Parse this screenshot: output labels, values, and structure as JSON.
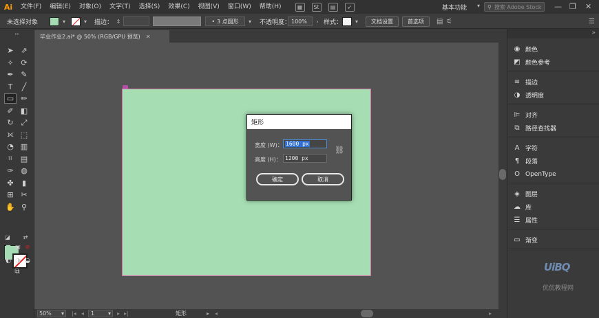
{
  "app": {
    "logo": "Ai"
  },
  "menu": [
    "文件(F)",
    "编辑(E)",
    "对象(O)",
    "文字(T)",
    "选择(S)",
    "效果(C)",
    "视图(V)",
    "窗口(W)",
    "帮助(H)"
  ],
  "menu_icons": [
    "br-icon",
    "stock-icon",
    "arrange-documents-icon",
    "gpu-performance-icon"
  ],
  "menu_icon_glyphs": [
    "▦",
    "St",
    "▤",
    "➶"
  ],
  "workspace": {
    "label": "基本功能"
  },
  "search": {
    "placeholder": "搜索 Adobe Stock"
  },
  "window_controls": [
    "—",
    "❐",
    "✕"
  ],
  "control_bar": {
    "selection": "未选择对象",
    "fill_color": "#a6dcb3",
    "stroke_label": "描边：",
    "brush": "3 点圆形",
    "opacity_label": "不透明度：",
    "opacity_value": "100%",
    "style_label": "样式：",
    "doc_setup": "文档设置",
    "preferences": "首选项"
  },
  "document_tab": {
    "title": "毕业作业2.ai* @ 50% (RGB/GPU 预览)",
    "close": "✕"
  },
  "tools": [
    "selection-tool",
    "direct-selection-tool",
    "magic-wand-tool",
    "lasso-tool",
    "pen-tool",
    "curvature-tool",
    "type-tool",
    "line-tool",
    "rectangle-tool",
    "paintbrush-tool",
    "shaper-tool",
    "eraser-tool",
    "rotate-tool",
    "scale-tool",
    "width-tool",
    "free-transform-tool",
    "shape-builder-tool",
    "perspective-grid-tool",
    "mesh-tool",
    "gradient-tool",
    "eyedropper-tool",
    "blend-tool",
    "symbol-sprayer-tool",
    "column-graph-tool",
    "artboard-tool",
    "slice-tool",
    "hand-tool",
    "zoom-tool"
  ],
  "tool_glyphs": [
    "➤",
    "⇗",
    "✧",
    "⟳",
    "✒",
    "✎",
    "T",
    "╱",
    "▭",
    "✏",
    "✐",
    "◧",
    "↻",
    "⤢",
    "⟗",
    "⬚",
    "◔",
    "▥",
    "⌗",
    "▤",
    "✑",
    "◍",
    "✤",
    "▮",
    "⊞",
    "✂",
    "✋",
    "⚲"
  ],
  "canvas": {
    "artboard_color": "#a6ddb3"
  },
  "dialog": {
    "title": "矩形",
    "width_label": "宽度 (W)：",
    "width_value": "1600 px",
    "height_label": "高度 (H)：",
    "height_value": "1200 px",
    "ok": "确定",
    "cancel": "取消"
  },
  "status": {
    "zoom": "50%",
    "page": "1",
    "tool": "矩形"
  },
  "panels": [
    [
      {
        "icon": "color-icon",
        "glyph": "◉",
        "label": "颜色"
      },
      {
        "icon": "color-guide-icon",
        "glyph": "◩",
        "label": "颜色参考"
      }
    ],
    [
      {
        "icon": "stroke-icon",
        "glyph": "≡",
        "label": "描边"
      },
      {
        "icon": "transparency-icon",
        "glyph": "◑",
        "label": "透明度"
      }
    ],
    [
      {
        "icon": "align-icon",
        "glyph": "⊫",
        "label": "对齐"
      },
      {
        "icon": "pathfinder-icon",
        "glyph": "⧉",
        "label": "路径查找器"
      }
    ],
    [
      {
        "icon": "character-icon",
        "glyph": "A",
        "label": "字符"
      },
      {
        "icon": "paragraph-icon",
        "glyph": "¶",
        "label": "段落"
      },
      {
        "icon": "opentype-icon",
        "glyph": "O",
        "label": "OpenType"
      }
    ],
    [
      {
        "icon": "layers-icon",
        "glyph": "◈",
        "label": "图层"
      },
      {
        "icon": "libraries-icon",
        "glyph": "☁",
        "label": "库"
      },
      {
        "icon": "properties-icon",
        "glyph": "☰",
        "label": "属性"
      }
    ],
    [
      {
        "icon": "gradient-icon",
        "glyph": "▭",
        "label": "渐变"
      }
    ]
  ],
  "watermark": {
    "logo": "UiBQ",
    "text": "优优教程网"
  }
}
